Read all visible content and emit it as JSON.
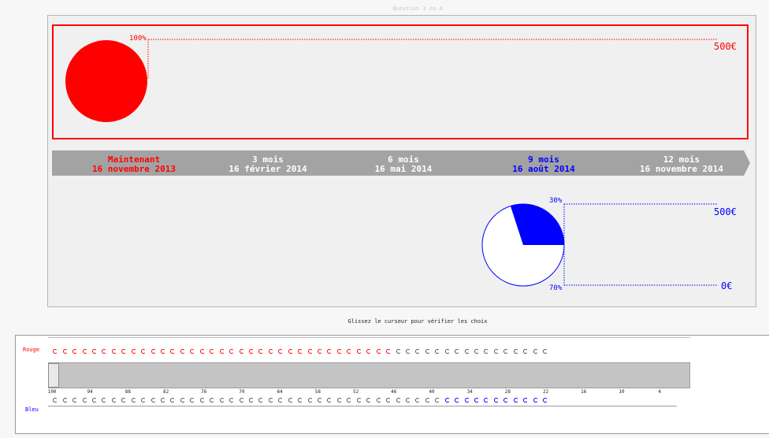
{
  "header": {
    "question_label": "Question 3 on 4"
  },
  "option_top": {
    "color": "#ff0000",
    "probability_label": "100%",
    "amount_label": "500€"
  },
  "timeline": {
    "points": [
      {
        "line1": "Maintenant",
        "line2": "16 novembre 2013",
        "color": "red"
      },
      {
        "line1": "3 mois",
        "line2": "16 février 2014",
        "color": "white"
      },
      {
        "line1": "6 mois",
        "line2": "16 mai 2014",
        "color": "white"
      },
      {
        "line1": "9 mois",
        "line2": "16 août 2014",
        "color": "blue"
      },
      {
        "line1": "12 mois",
        "line2": "16 novembre 2014",
        "color": "white"
      }
    ]
  },
  "option_bottom": {
    "color": "#0000ff",
    "win_probability_label": "30%",
    "win_amount_label": "500€",
    "lose_probability_label": "70%",
    "lose_amount_label": "0€",
    "win_fraction": 0.3
  },
  "instructions": {
    "text": "Glissez le curseur pour vérifier les choix"
  },
  "choice_list": {
    "top_label": "Rouge",
    "bottom_label": "Bleu",
    "total_choices": 51,
    "red_selected_count": 35,
    "blue_selected_count": 11,
    "tick_labels": [
      "100",
      "94",
      "88",
      "82",
      "76",
      "70",
      "64",
      "58",
      "52",
      "46",
      "40",
      "34",
      "28",
      "22",
      "16",
      "10",
      "4"
    ],
    "slider_value": 100
  }
}
